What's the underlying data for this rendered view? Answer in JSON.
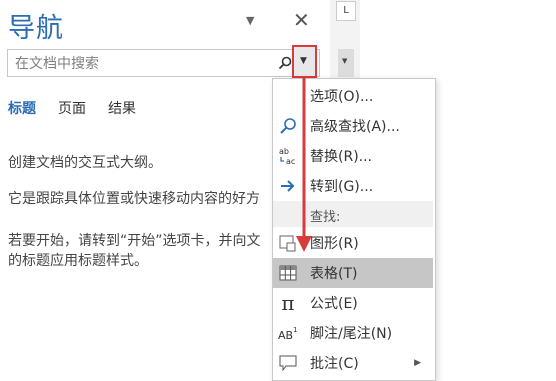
{
  "nav_pane": {
    "title": "导航",
    "search_placeholder": "在文档中搜索",
    "tabs": [
      "标题",
      "页面",
      "结果"
    ],
    "paragraphs": [
      "创建文档的交互式大纲。",
      "它是跟踪具体位置或快速移动内容的好方",
      "若要开始，请转到“开始”选项卡，并向文",
      "的标题应用标题样式。"
    ]
  },
  "ruler_corner_label": "L",
  "menu": {
    "items": [
      {
        "label": "选项(O)...",
        "icon": "none"
      },
      {
        "label": "高级查找(A)...",
        "icon": "search-icon"
      },
      {
        "label": "替换(R)...",
        "icon": "replace-icon"
      },
      {
        "label": "转到(G)...",
        "icon": "arrow-right-icon"
      }
    ],
    "find_header": "查找:",
    "find_items": [
      {
        "label": "图形(R)",
        "icon": "graphic-icon"
      },
      {
        "label": "表格(T)",
        "icon": "table-icon",
        "highlighted": true
      },
      {
        "label": "公式(E)",
        "icon": "pi-icon"
      },
      {
        "label": "脚注/尾注(N)",
        "icon": "footnote-icon"
      },
      {
        "label": "批注(C)",
        "icon": "comment-icon",
        "has_submenu": true
      }
    ]
  },
  "colors": {
    "title_blue": "#2b6cb5",
    "callout_red": "#d93a3a",
    "highlight_gray": "#c6c6c6"
  }
}
